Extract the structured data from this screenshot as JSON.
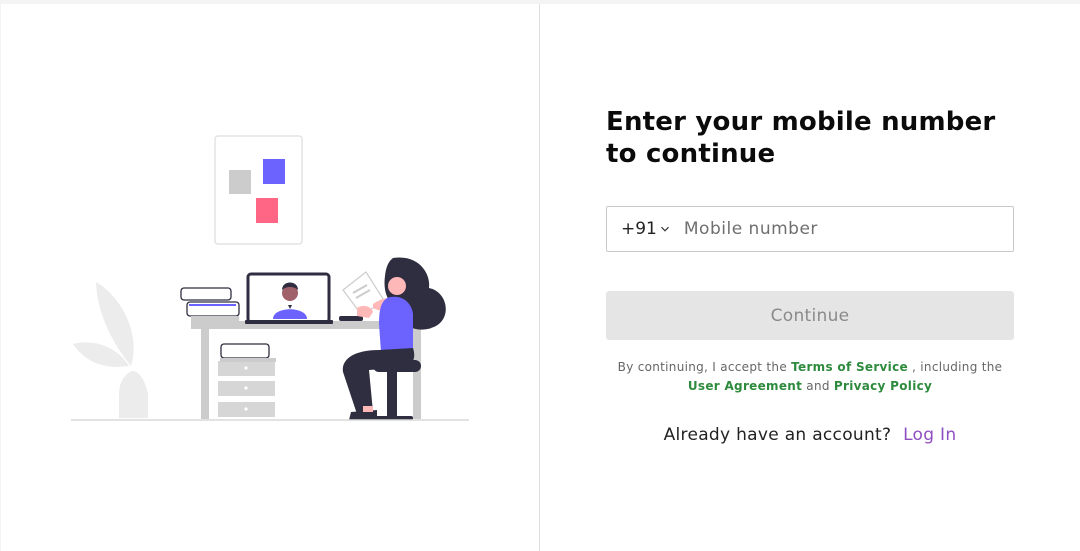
{
  "form": {
    "title": "Enter your mobile number to continue",
    "country_code": "+91",
    "mobile_placeholder": "Mobile number",
    "continue_label": "Continue",
    "terms_prefix": "By continuing, I accept the ",
    "terms_of_service": "Terms of Service",
    "terms_middle": " , including the ",
    "user_agreement": "User Agreement",
    "terms_and": " and ",
    "privacy_policy": "Privacy Policy",
    "account_question": "Already have an account?",
    "login_label": "Log In"
  },
  "colors": {
    "card_background": "#ffffff",
    "page_background": "#f4f4f4",
    "continue_disabled_bg": "#e5e5e5",
    "link_green": "#2e8b3e",
    "login_purple": "#8e4fc0",
    "illustration_purple": "#6c63ff",
    "illustration_pink": "#ff6584",
    "illustration_grey": "#cccccc",
    "illustration_dark": "#2f2e41"
  },
  "icons": {
    "country_dropdown": "chevron-down-icon"
  }
}
